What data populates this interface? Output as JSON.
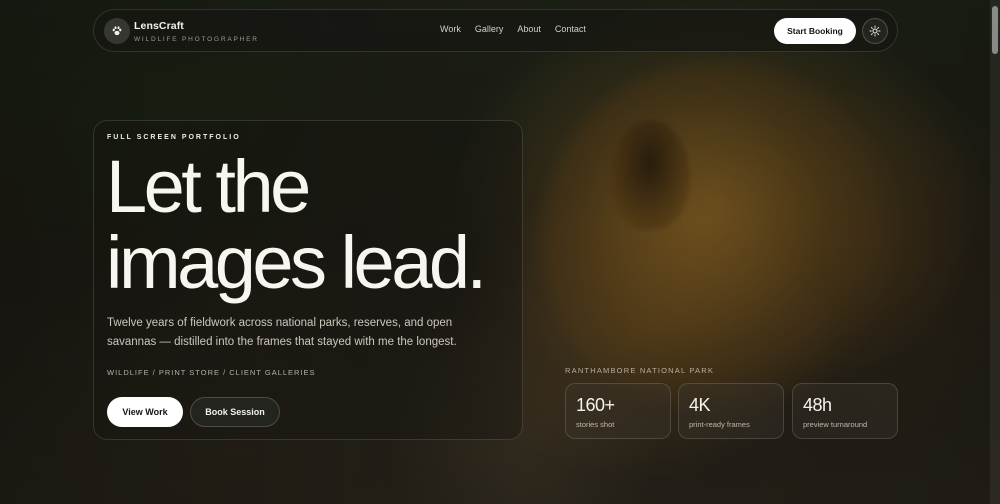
{
  "brand": {
    "name": "LensCraft",
    "tagline": "WILDLIFE PHOTOGRAPHER",
    "logo_icon": "paw-icon"
  },
  "nav": {
    "links": [
      "Work",
      "Gallery",
      "About",
      "Contact"
    ],
    "cta_label": "Start Booking",
    "theme_icon": "sun-icon"
  },
  "hero": {
    "eyebrow": "FULL SCREEN PORTFOLIO",
    "headline_line1": "Let the",
    "headline_line2": "images lead.",
    "description": "Twelve years of fieldwork across national parks, reserves, and open savannas — distilled into the frames that stayed with me the longest.",
    "tags": "WILDLIFE / PRINT STORE / CLIENT GALLERIES",
    "primary_button": "View Work",
    "secondary_button": "Book Session"
  },
  "location": "RANTHAMBORE NATIONAL PARK",
  "stats": [
    {
      "value": "160+",
      "label": "stories shot"
    },
    {
      "value": "4K",
      "label": "print-ready frames"
    },
    {
      "value": "48h",
      "label": "preview turnaround"
    }
  ],
  "colors": {
    "accent_button": "#ffffff",
    "text_primary": "#f8f6f0"
  }
}
